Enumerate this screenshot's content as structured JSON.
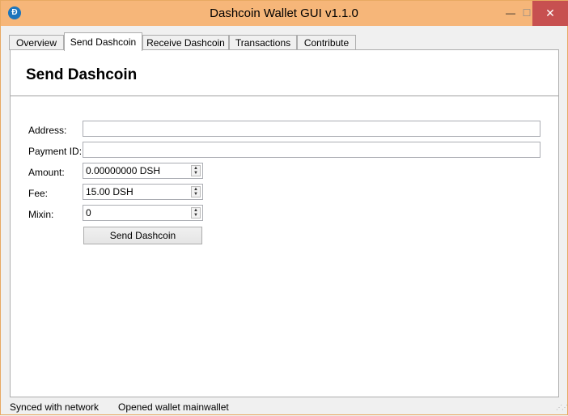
{
  "window": {
    "title": "Dashcoin Wallet GUI v1.1.0",
    "icon": "dashcoin-icon",
    "icon_glyph": "Đ",
    "controls": {
      "minimize": "—",
      "maximize": "☐",
      "close": "✕"
    }
  },
  "tabs": [
    {
      "label": "Overview",
      "active": false
    },
    {
      "label": "Send Dashcoin",
      "active": true
    },
    {
      "label": "Receive Dashcoin",
      "active": false
    },
    {
      "label": "Transactions",
      "active": false
    },
    {
      "label": "Contribute",
      "active": false
    }
  ],
  "send": {
    "title": "Send Dashcoin",
    "address_label": "Address:",
    "address_value": "",
    "payment_id_label": "Payment ID:",
    "payment_id_value": "",
    "amount_label": "Amount:",
    "amount_value": "0.00000000 DSH",
    "fee_label": "Fee:",
    "fee_value": "15.00 DSH",
    "mixin_label": "Mixin:",
    "mixin_value": "0",
    "send_button": "Send Dashcoin"
  },
  "status": {
    "sync": "Synced with network",
    "wallet": "Opened wallet mainwallet"
  },
  "colors": {
    "titlebar": "#f6b679",
    "close_button": "#c75050",
    "app_icon": "#1c75bc"
  }
}
